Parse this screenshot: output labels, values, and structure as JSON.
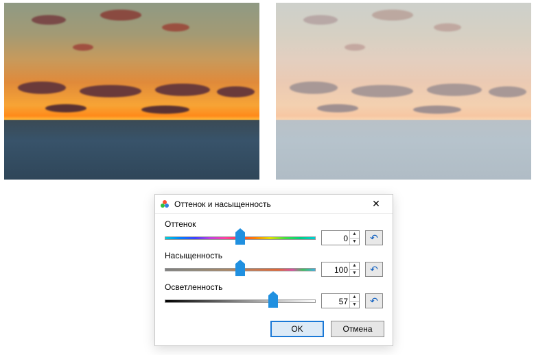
{
  "dialog": {
    "title": "Оттенок и насыщенность",
    "rows": {
      "hue": {
        "label": "Оттенок",
        "value": "0",
        "thumb_pct": 50
      },
      "sat": {
        "label": "Насыщенность",
        "value": "100",
        "thumb_pct": 50
      },
      "light": {
        "label": "Осветленность",
        "value": "57",
        "thumb_pct": 72
      }
    },
    "buttons": {
      "ok": "OK",
      "cancel": "Отмена"
    },
    "close_glyph": "✕",
    "reset_glyph": "↶",
    "spin_up": "▲",
    "spin_down": "▼"
  }
}
